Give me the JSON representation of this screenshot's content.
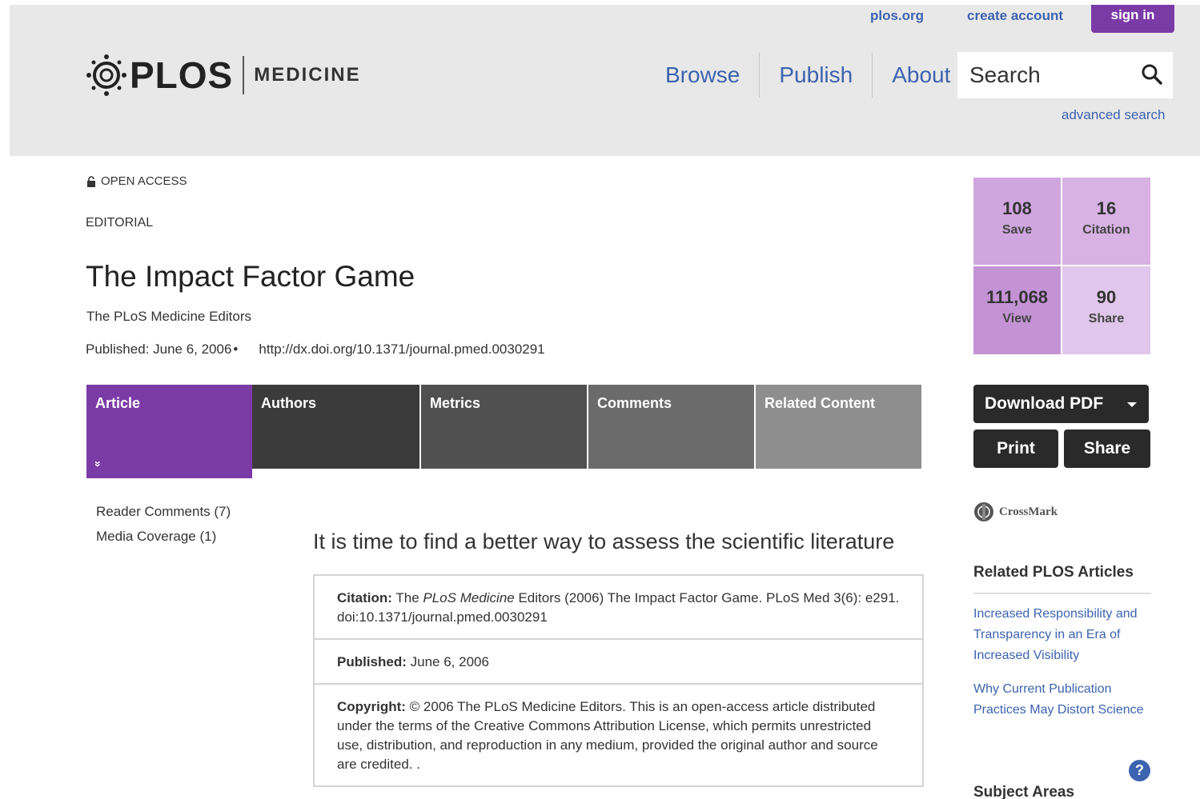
{
  "header": {
    "top_links": {
      "plos_org": "plos.org",
      "create_account": "create account",
      "sign_in": "sign in"
    },
    "logo": {
      "plos": "PLOS",
      "journal": "MEDICINE"
    },
    "nav": [
      "Browse",
      "Publish",
      "About"
    ],
    "search": {
      "placeholder": "Search",
      "advanced": "advanced search"
    }
  },
  "article": {
    "access": "OPEN ACCESS",
    "type": "EDITORIAL",
    "title": "The Impact Factor Game",
    "authors": "The PLoS Medicine Editors",
    "published_line": "Published: June 6, 2006",
    "bullet": "•",
    "doi": "http://dx.doi.org/10.1371/journal.pmed.0030291"
  },
  "tabs": [
    "Article",
    "Authors",
    "Metrics",
    "Comments",
    "Related Content"
  ],
  "tab_chevron": "»",
  "side_links": [
    "Reader Comments (7)",
    "Media Coverage (1)"
  ],
  "lede": "It is time to find a better way to assess the scientific literature",
  "info": {
    "citation_label": "Citation:",
    "citation_pre": "The ",
    "citation_em": "PLoS Medicine",
    "citation_post": " Editors (2006) The Impact Factor Game. PLoS Med 3(6): e291. doi:10.1371/journal.pmed.0030291",
    "published_label": "Published:",
    "published_value": "June 6, 2006",
    "copyright_label": "Copyright:",
    "copyright_value": "© 2006 The PLoS Medicine Editors. This is an open-access article distributed under the terms of the Creative Commons Attribution License, which permits unrestricted use, distribution, and reproduction in any medium, provided the original author and source are credited. ."
  },
  "metrics": [
    {
      "value": "108",
      "label": "Save"
    },
    {
      "value": "16",
      "label": "Citation"
    },
    {
      "value": "111,068",
      "label": "View"
    },
    {
      "value": "90",
      "label": "Share"
    }
  ],
  "actions": {
    "download": "Download PDF",
    "print": "Print",
    "share": "Share"
  },
  "crossmark": "CrossMark",
  "related": {
    "heading": "Related PLOS Articles",
    "links": [
      "Increased Responsibility and Transparency in an Era of Increased Visibility",
      "Why Current Publication Practices May Distort Science"
    ]
  },
  "help": "?",
  "subject_heading": "Subject Areas",
  "colors": {
    "brand_purple": "#7b3ba7",
    "link_blue": "#3c63af",
    "header_gray": "#e8e8e8"
  }
}
